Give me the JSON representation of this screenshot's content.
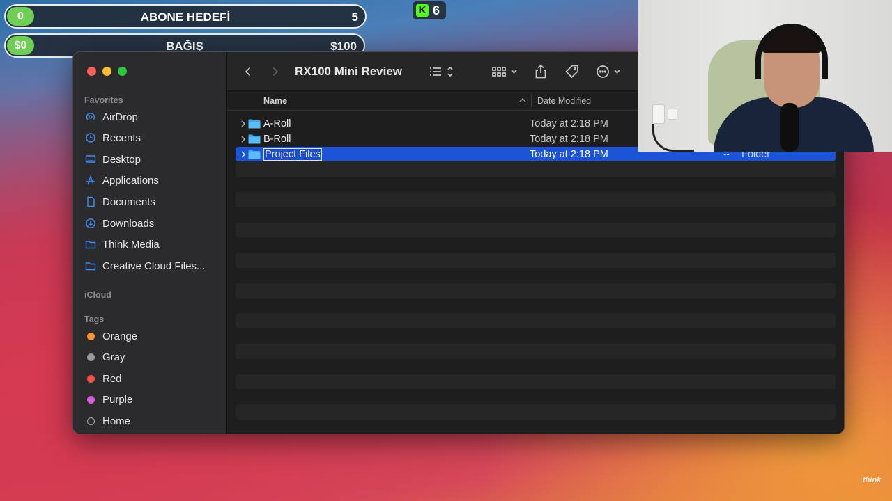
{
  "overlay": {
    "subscriber_goal": {
      "current": "0",
      "label": "ABONE HEDEFİ",
      "target": "5"
    },
    "donation_goal": {
      "current": "$0",
      "label": "BAĞIŞ",
      "target": "$100"
    },
    "kick_viewers": "6"
  },
  "window": {
    "title": "RX100 Mini Review",
    "colors": {
      "selection": "#1b54d6",
      "sidebar": "#2b2b2d",
      "content": "#1e1e1e"
    }
  },
  "sidebar": {
    "favorites_heading": "Favorites",
    "favorites": [
      {
        "label": "AirDrop",
        "icon": "airdrop-icon"
      },
      {
        "label": "Recents",
        "icon": "clock-icon"
      },
      {
        "label": "Desktop",
        "icon": "desktop-icon"
      },
      {
        "label": "Applications",
        "icon": "applications-icon"
      },
      {
        "label": "Documents",
        "icon": "document-icon"
      },
      {
        "label": "Downloads",
        "icon": "download-icon"
      },
      {
        "label": "Think Media",
        "icon": "folder-icon"
      },
      {
        "label": "Creative Cloud Files...",
        "icon": "folder-icon"
      }
    ],
    "icloud_heading": "iCloud",
    "tags_heading": "Tags",
    "tags": [
      {
        "label": "Orange",
        "color": "#f7932f"
      },
      {
        "label": "Gray",
        "color": "#9a9a9c"
      },
      {
        "label": "Red",
        "color": "#fb4f47"
      },
      {
        "label": "Purple",
        "color": "#d65fe0"
      },
      {
        "label": "Home",
        "color": "hollow"
      }
    ]
  },
  "columns": {
    "name": "Name",
    "date_modified": "Date Modified"
  },
  "files": [
    {
      "name": "A-Roll",
      "date": "Today at 2:18 PM"
    },
    {
      "name": "B-Roll",
      "date": "Today at 2:18 PM"
    },
    {
      "name": "Project Files",
      "date": "Today at 2:18 PM",
      "size": "--",
      "kind": "Folder",
      "selected": true
    }
  ],
  "watermark": "think"
}
